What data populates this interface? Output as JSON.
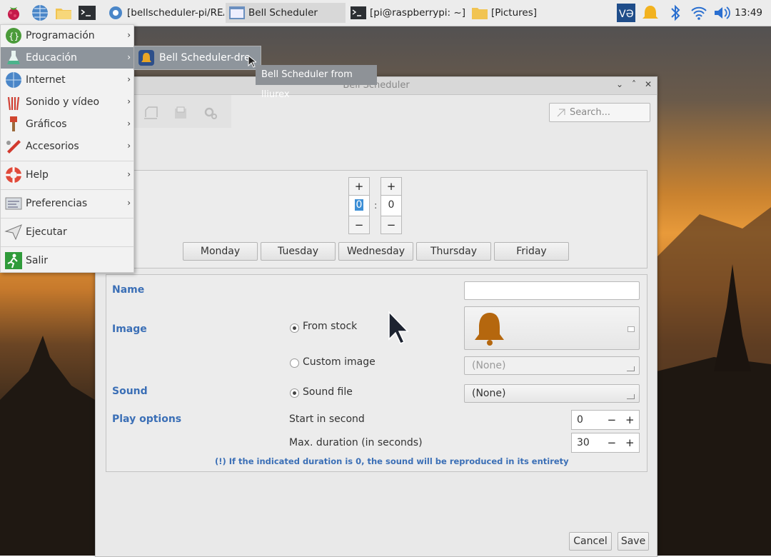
{
  "taskbar": {
    "tasks": [
      {
        "label": "[bellscheduler-pi/REA..."
      },
      {
        "label": "Bell Scheduler"
      },
      {
        "label": "[pi@raspberrypi: ~]"
      },
      {
        "label": "[Pictures]"
      }
    ],
    "clock": "13:49"
  },
  "start_menu": {
    "items": [
      {
        "label": "Programación"
      },
      {
        "label": "Educación"
      },
      {
        "label": "Internet"
      },
      {
        "label": "Sonido y vídeo"
      },
      {
        "label": "Gráficos"
      },
      {
        "label": "Accesorios"
      },
      {
        "label": "Help"
      },
      {
        "label": "Preferencias"
      },
      {
        "label": "Ejecutar"
      },
      {
        "label": "Salir"
      }
    ],
    "submenu_item": "Bell Scheduler-dre",
    "tooltip": "Bell Scheduler from lliurex"
  },
  "window": {
    "title": "Bell Scheduler",
    "search_placeholder": "Search...",
    "hour": "0",
    "minute": "0",
    "plus": "+",
    "minus": "−",
    "days": [
      "Monday",
      "Tuesday",
      "Wednesday",
      "Thursday",
      "Friday"
    ],
    "form": {
      "name_label": "Name",
      "image_label": "Image",
      "from_stock": "From stock",
      "custom_image": "Custom image",
      "custom_image_value": "(None)",
      "sound_label": "Sound",
      "sound_file": "Sound file",
      "sound_file_value": "(None)",
      "play_options_label": "Play options",
      "start_in_second": "Start in second",
      "start_value": "0",
      "max_duration": "Max. duration (in seconds)",
      "max_value": "30",
      "note": "(!) If the indicated duration is 0, the sound will be reproduced in its entirety"
    },
    "cancel": "Cancel",
    "save": "Save"
  }
}
